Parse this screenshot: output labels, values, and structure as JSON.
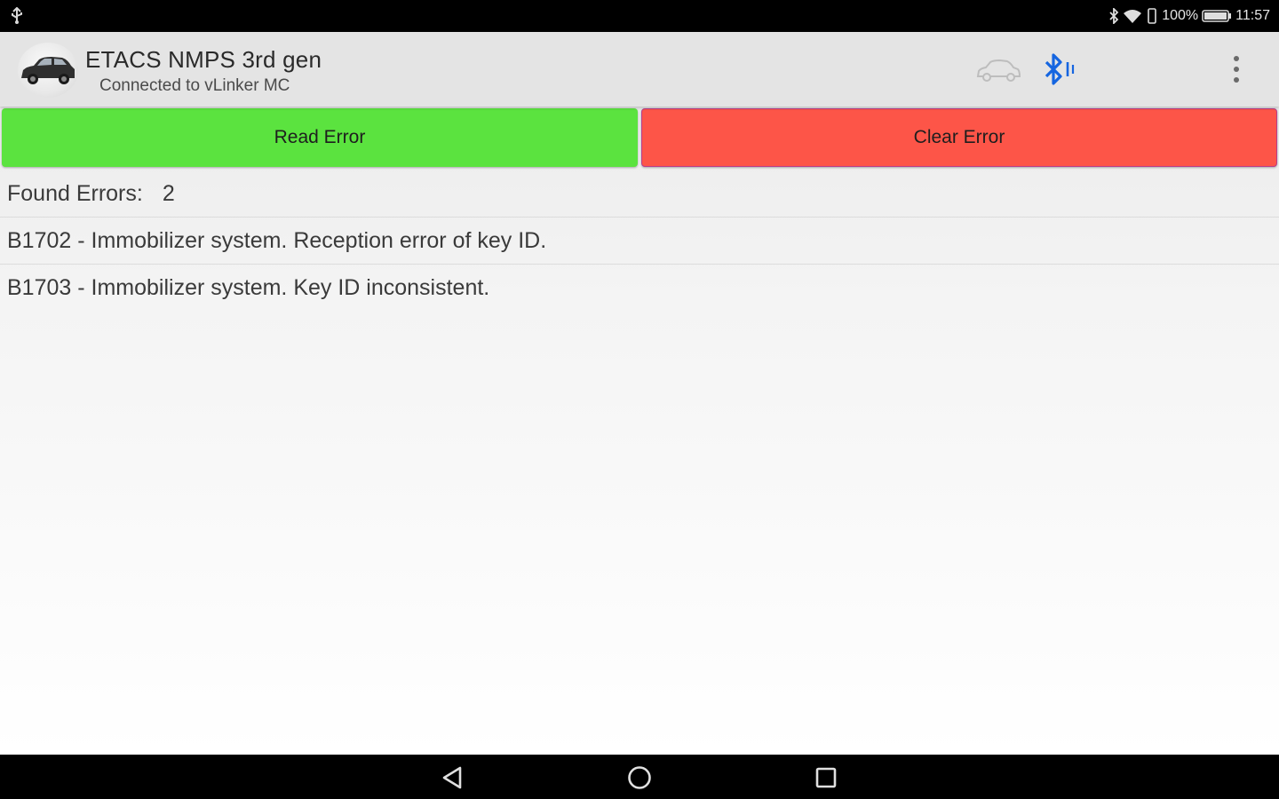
{
  "status_bar": {
    "battery_percent": "100%",
    "time": "11:57",
    "icons": [
      "usb-icon",
      "bluetooth-icon",
      "wifi-icon",
      "vibrate-icon",
      "battery-icon"
    ]
  },
  "app_bar": {
    "title": "ETACS NMPS 3rd gen",
    "subtitle": "Connected to vLinker MC",
    "icons": [
      "car-logo-icon",
      "car-outline-icon",
      "bluetooth-connected-icon",
      "more-vert-icon"
    ]
  },
  "actions": {
    "read_label": "Read Error",
    "clear_label": "Clear Error",
    "read_color": "#5be33f",
    "clear_color": "#fd5548"
  },
  "results": {
    "found_label": "Found Errors:",
    "found_count": "2",
    "errors": [
      "B1702 - Immobilizer system. Reception error of key ID.",
      "B1703 - Immobilizer system. Key ID inconsistent."
    ]
  },
  "nav_bar": {
    "icons": [
      "back-icon",
      "home-icon",
      "recents-icon"
    ]
  },
  "colors": {
    "bluetooth_accent": "#1565e0",
    "app_bar_bg": "#e4e4e4"
  }
}
